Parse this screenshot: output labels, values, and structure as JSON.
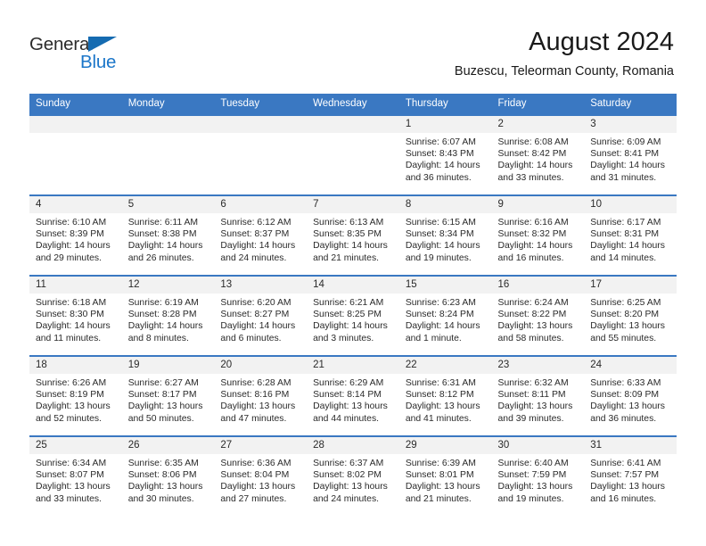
{
  "brand": {
    "name_top": "General",
    "name_bottom": "Blue",
    "accent_color": "#1b76c9",
    "triangle_color": "#156bb1"
  },
  "header": {
    "title": "August 2024",
    "location": "Buzescu, Teleorman County, Romania"
  },
  "calendar": {
    "header_bg": "#3a78c2",
    "daynum_bg": "#f2f2f2",
    "weekdays": [
      "Sunday",
      "Monday",
      "Tuesday",
      "Wednesday",
      "Thursday",
      "Friday",
      "Saturday"
    ],
    "weeks": [
      [
        {
          "day": "",
          "empty": true
        },
        {
          "day": "",
          "empty": true
        },
        {
          "day": "",
          "empty": true
        },
        {
          "day": "",
          "empty": true
        },
        {
          "day": "1",
          "sunrise": "Sunrise: 6:07 AM",
          "sunset": "Sunset: 8:43 PM",
          "daylight1": "Daylight: 14 hours",
          "daylight2": "and 36 minutes."
        },
        {
          "day": "2",
          "sunrise": "Sunrise: 6:08 AM",
          "sunset": "Sunset: 8:42 PM",
          "daylight1": "Daylight: 14 hours",
          "daylight2": "and 33 minutes."
        },
        {
          "day": "3",
          "sunrise": "Sunrise: 6:09 AM",
          "sunset": "Sunset: 8:41 PM",
          "daylight1": "Daylight: 14 hours",
          "daylight2": "and 31 minutes."
        }
      ],
      [
        {
          "day": "4",
          "sunrise": "Sunrise: 6:10 AM",
          "sunset": "Sunset: 8:39 PM",
          "daylight1": "Daylight: 14 hours",
          "daylight2": "and 29 minutes."
        },
        {
          "day": "5",
          "sunrise": "Sunrise: 6:11 AM",
          "sunset": "Sunset: 8:38 PM",
          "daylight1": "Daylight: 14 hours",
          "daylight2": "and 26 minutes."
        },
        {
          "day": "6",
          "sunrise": "Sunrise: 6:12 AM",
          "sunset": "Sunset: 8:37 PM",
          "daylight1": "Daylight: 14 hours",
          "daylight2": "and 24 minutes."
        },
        {
          "day": "7",
          "sunrise": "Sunrise: 6:13 AM",
          "sunset": "Sunset: 8:35 PM",
          "daylight1": "Daylight: 14 hours",
          "daylight2": "and 21 minutes."
        },
        {
          "day": "8",
          "sunrise": "Sunrise: 6:15 AM",
          "sunset": "Sunset: 8:34 PM",
          "daylight1": "Daylight: 14 hours",
          "daylight2": "and 19 minutes."
        },
        {
          "day": "9",
          "sunrise": "Sunrise: 6:16 AM",
          "sunset": "Sunset: 8:32 PM",
          "daylight1": "Daylight: 14 hours",
          "daylight2": "and 16 minutes."
        },
        {
          "day": "10",
          "sunrise": "Sunrise: 6:17 AM",
          "sunset": "Sunset: 8:31 PM",
          "daylight1": "Daylight: 14 hours",
          "daylight2": "and 14 minutes."
        }
      ],
      [
        {
          "day": "11",
          "sunrise": "Sunrise: 6:18 AM",
          "sunset": "Sunset: 8:30 PM",
          "daylight1": "Daylight: 14 hours",
          "daylight2": "and 11 minutes."
        },
        {
          "day": "12",
          "sunrise": "Sunrise: 6:19 AM",
          "sunset": "Sunset: 8:28 PM",
          "daylight1": "Daylight: 14 hours",
          "daylight2": "and 8 minutes."
        },
        {
          "day": "13",
          "sunrise": "Sunrise: 6:20 AM",
          "sunset": "Sunset: 8:27 PM",
          "daylight1": "Daylight: 14 hours",
          "daylight2": "and 6 minutes."
        },
        {
          "day": "14",
          "sunrise": "Sunrise: 6:21 AM",
          "sunset": "Sunset: 8:25 PM",
          "daylight1": "Daylight: 14 hours",
          "daylight2": "and 3 minutes."
        },
        {
          "day": "15",
          "sunrise": "Sunrise: 6:23 AM",
          "sunset": "Sunset: 8:24 PM",
          "daylight1": "Daylight: 14 hours",
          "daylight2": "and 1 minute."
        },
        {
          "day": "16",
          "sunrise": "Sunrise: 6:24 AM",
          "sunset": "Sunset: 8:22 PM",
          "daylight1": "Daylight: 13 hours",
          "daylight2": "and 58 minutes."
        },
        {
          "day": "17",
          "sunrise": "Sunrise: 6:25 AM",
          "sunset": "Sunset: 8:20 PM",
          "daylight1": "Daylight: 13 hours",
          "daylight2": "and 55 minutes."
        }
      ],
      [
        {
          "day": "18",
          "sunrise": "Sunrise: 6:26 AM",
          "sunset": "Sunset: 8:19 PM",
          "daylight1": "Daylight: 13 hours",
          "daylight2": "and 52 minutes."
        },
        {
          "day": "19",
          "sunrise": "Sunrise: 6:27 AM",
          "sunset": "Sunset: 8:17 PM",
          "daylight1": "Daylight: 13 hours",
          "daylight2": "and 50 minutes."
        },
        {
          "day": "20",
          "sunrise": "Sunrise: 6:28 AM",
          "sunset": "Sunset: 8:16 PM",
          "daylight1": "Daylight: 13 hours",
          "daylight2": "and 47 minutes."
        },
        {
          "day": "21",
          "sunrise": "Sunrise: 6:29 AM",
          "sunset": "Sunset: 8:14 PM",
          "daylight1": "Daylight: 13 hours",
          "daylight2": "and 44 minutes."
        },
        {
          "day": "22",
          "sunrise": "Sunrise: 6:31 AM",
          "sunset": "Sunset: 8:12 PM",
          "daylight1": "Daylight: 13 hours",
          "daylight2": "and 41 minutes."
        },
        {
          "day": "23",
          "sunrise": "Sunrise: 6:32 AM",
          "sunset": "Sunset: 8:11 PM",
          "daylight1": "Daylight: 13 hours",
          "daylight2": "and 39 minutes."
        },
        {
          "day": "24",
          "sunrise": "Sunrise: 6:33 AM",
          "sunset": "Sunset: 8:09 PM",
          "daylight1": "Daylight: 13 hours",
          "daylight2": "and 36 minutes."
        }
      ],
      [
        {
          "day": "25",
          "sunrise": "Sunrise: 6:34 AM",
          "sunset": "Sunset: 8:07 PM",
          "daylight1": "Daylight: 13 hours",
          "daylight2": "and 33 minutes."
        },
        {
          "day": "26",
          "sunrise": "Sunrise: 6:35 AM",
          "sunset": "Sunset: 8:06 PM",
          "daylight1": "Daylight: 13 hours",
          "daylight2": "and 30 minutes."
        },
        {
          "day": "27",
          "sunrise": "Sunrise: 6:36 AM",
          "sunset": "Sunset: 8:04 PM",
          "daylight1": "Daylight: 13 hours",
          "daylight2": "and 27 minutes."
        },
        {
          "day": "28",
          "sunrise": "Sunrise: 6:37 AM",
          "sunset": "Sunset: 8:02 PM",
          "daylight1": "Daylight: 13 hours",
          "daylight2": "and 24 minutes."
        },
        {
          "day": "29",
          "sunrise": "Sunrise: 6:39 AM",
          "sunset": "Sunset: 8:01 PM",
          "daylight1": "Daylight: 13 hours",
          "daylight2": "and 21 minutes."
        },
        {
          "day": "30",
          "sunrise": "Sunrise: 6:40 AM",
          "sunset": "Sunset: 7:59 PM",
          "daylight1": "Daylight: 13 hours",
          "daylight2": "and 19 minutes."
        },
        {
          "day": "31",
          "sunrise": "Sunrise: 6:41 AM",
          "sunset": "Sunset: 7:57 PM",
          "daylight1": "Daylight: 13 hours",
          "daylight2": "and 16 minutes."
        }
      ]
    ]
  }
}
